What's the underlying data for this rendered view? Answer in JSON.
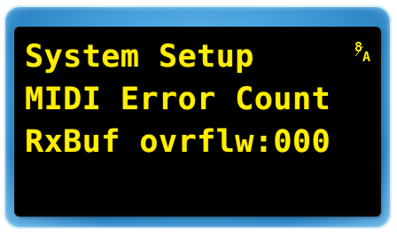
{
  "display": {
    "line1": "System Setup",
    "line2": "MIDI Error Count",
    "line3": "RxBuf ovrflw:000",
    "indicator": {
      "top": "8",
      "bottom": "A",
      "icon": "glyph-indicator-icon"
    }
  },
  "colors": {
    "text": "#ffee00",
    "screen": "#000000",
    "bezel": "#4aa3dd"
  }
}
